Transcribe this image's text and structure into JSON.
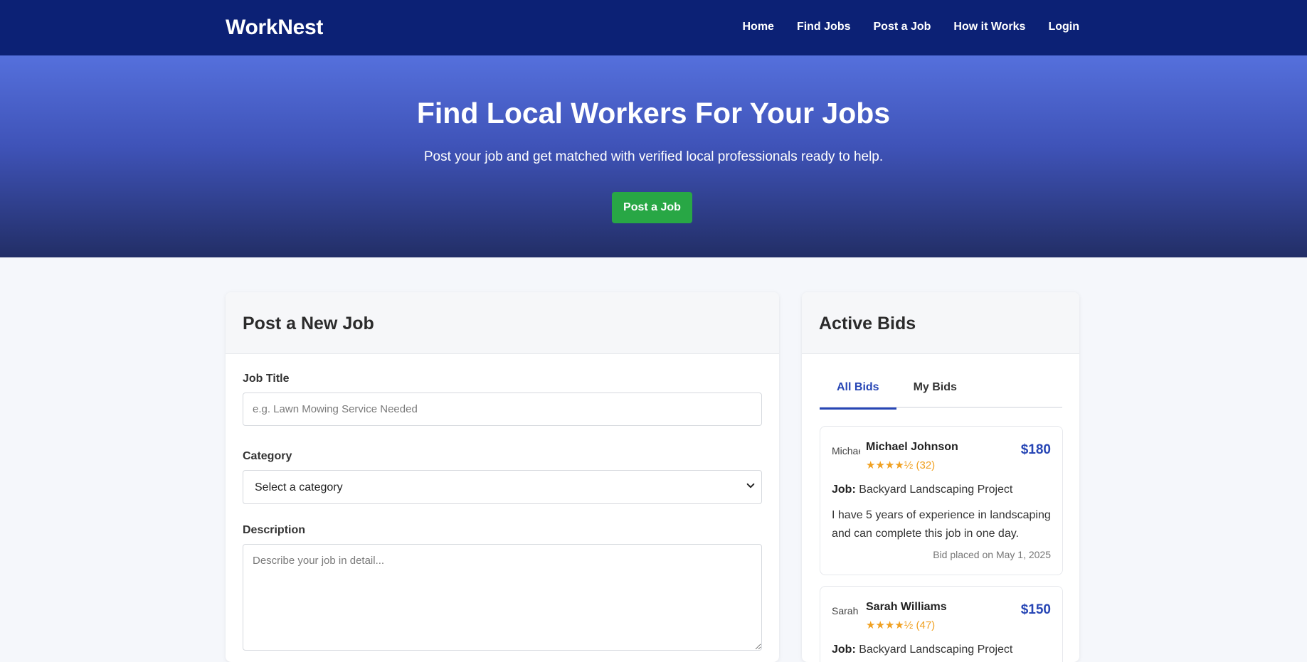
{
  "header": {
    "brand": "WorkNest",
    "nav": [
      "Home",
      "Find Jobs",
      "Post a Job",
      "How it Works",
      "Login"
    ]
  },
  "hero": {
    "title": "Find Local Workers For Your Jobs",
    "subtitle": "Post your job and get matched with verified local professionals ready to help.",
    "cta": "Post a Job"
  },
  "post_form": {
    "heading": "Post a New Job",
    "job_title_label": "Job Title",
    "job_title_placeholder": "e.g. Lawn Mowing Service Needed",
    "category_label": "Category",
    "category_selected": "Select a category",
    "description_label": "Description",
    "description_placeholder": "Describe your job in detail..."
  },
  "bids": {
    "heading": "Active Bids",
    "tabs": [
      "All Bids",
      "My Bids"
    ],
    "items": [
      {
        "avatar_alt": "Michael Johnson",
        "name": "Michael Johnson",
        "stars": "★★★★½",
        "reviews": "(32)",
        "price": "$180",
        "job_label": "Job:",
        "job": "Backyard Landscaping Project",
        "message": "I have 5 years of experience in landscaping and can complete this job in one day.",
        "date": "Bid placed on May 1, 2025"
      },
      {
        "avatar_alt": "Sarah Williams",
        "name": "Sarah Williams",
        "stars": "★★★★½",
        "reviews": "(47)",
        "price": "$150",
        "job_label": "Job:",
        "job": "Backyard Landscaping Project"
      }
    ]
  },
  "colors": {
    "header_bg": "#0c2175",
    "accent": "#2746b5",
    "cta_green": "#28a745",
    "star": "#f0a020"
  }
}
